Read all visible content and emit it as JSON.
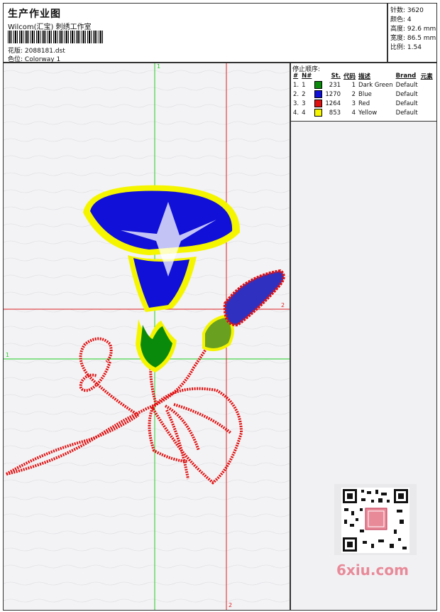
{
  "header": {
    "title": "生产作业图",
    "company": "Wilcom(汇宝) 刺绣工作室",
    "design_label": "花版:",
    "design_value": "2088181.dst",
    "colorway_label": "色位:",
    "colorway_value": "Colorway 1"
  },
  "stats": {
    "stitches": "针数: 3620",
    "colors": "颜色: 4",
    "height": "高度: 92.6 mm",
    "width": "宽度: 86.5 mm",
    "scale": "比例: 1.54"
  },
  "sequence": {
    "label": "停止顺序:",
    "headers": [
      "#",
      "N#",
      "St.",
      "代码",
      "描述",
      "Brand",
      "元素"
    ],
    "rows": [
      {
        "idx": "1.",
        "n": "1",
        "stitches": "231",
        "code": "1",
        "desc": "Dark Green",
        "brand": "Default",
        "color": "#0a8a0a"
      },
      {
        "idx": "2.",
        "n": "2",
        "stitches": "1270",
        "code": "2",
        "desc": "Blue",
        "brand": "Default",
        "color": "#1010d8"
      },
      {
        "idx": "3.",
        "n": "3",
        "stitches": "1264",
        "code": "3",
        "desc": "Red",
        "brand": "Default",
        "color": "#e01010"
      },
      {
        "idx": "4.",
        "n": "4",
        "stitches": "853",
        "code": "4",
        "desc": "Yellow",
        "brand": "Default",
        "color": "#f5f500"
      }
    ]
  },
  "guides": {
    "green_v_top": "1",
    "green_h_left": "1",
    "red_h_right": "2",
    "red_v_bottom": "2"
  },
  "colors": {
    "guide_green": "#22cc22",
    "guide_red": "#dd2222",
    "thread_red": "#e01010",
    "thread_blue": "#1010d8",
    "thread_yellow": "#f5f500",
    "thread_green": "#0a8a0a"
  },
  "watermark": "6xiu.com",
  "qr_stamp": "QR-code-with-seal"
}
